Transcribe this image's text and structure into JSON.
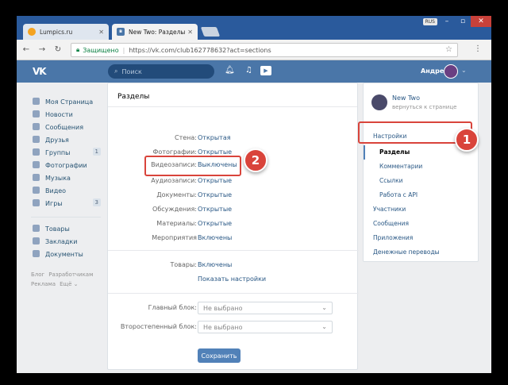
{
  "browser": {
    "tabs": [
      {
        "title": "Lumpics.ru",
        "active": false
      },
      {
        "title": "New Two: Разделы",
        "active": true
      }
    ],
    "lang_indicator": "RUS",
    "address": {
      "secure_label": "Защищено",
      "url": "https://vk.com/club162778632?act=sections"
    }
  },
  "vk_header": {
    "logo": "VK",
    "search_placeholder": "Поиск",
    "user_name": "Андрей"
  },
  "left_nav": {
    "items": [
      {
        "label": "Моя Страница",
        "icon": "home-icon"
      },
      {
        "label": "Новости",
        "icon": "news-icon"
      },
      {
        "label": "Сообщения",
        "icon": "messages-icon"
      },
      {
        "label": "Друзья",
        "icon": "friends-icon"
      },
      {
        "label": "Группы",
        "icon": "groups-icon",
        "count": "1"
      },
      {
        "label": "Фотографии",
        "icon": "photos-icon"
      },
      {
        "label": "Музыка",
        "icon": "music-icon"
      },
      {
        "label": "Видео",
        "icon": "video-icon"
      },
      {
        "label": "Игры",
        "icon": "games-icon",
        "count": "3"
      },
      {
        "label": "Товары",
        "icon": "goods-icon"
      },
      {
        "label": "Закладки",
        "icon": "bookmarks-icon"
      },
      {
        "label": "Документы",
        "icon": "documents-icon"
      }
    ],
    "footer": [
      "Блог",
      "Разработчикам",
      "Реклама",
      "Ещё ⌄"
    ]
  },
  "sections_panel": {
    "title": "Разделы",
    "rows": [
      {
        "label": "Стена:",
        "value": "Открытая"
      },
      {
        "label": "Фотографии:",
        "value": "Открытые"
      },
      {
        "label": "Видеозаписи:",
        "value": "Выключены"
      },
      {
        "label": "Аудиозаписи:",
        "value": "Открытые"
      },
      {
        "label": "Документы:",
        "value": "Открытые"
      },
      {
        "label": "Обсуждения:",
        "value": "Открытые"
      },
      {
        "label": "Материалы:",
        "value": "Открытые"
      },
      {
        "label": "Мероприятия",
        "value": "Включены"
      }
    ],
    "goods": {
      "label": "Товары:",
      "value": "Включены",
      "settings_link": "Показать настройки"
    },
    "main_block": {
      "label": "Главный блок:",
      "value": "Не выбрано"
    },
    "secondary_block": {
      "label": "Второстепенный блок:",
      "value": "Не выбрано"
    },
    "save_label": "Сохранить"
  },
  "right_menu": {
    "group_name": "New Two",
    "back_link": "вернуться к странице",
    "items": [
      {
        "label": "Настройки",
        "sub": false,
        "active": false
      },
      {
        "label": "Разделы",
        "sub": true,
        "active": true
      },
      {
        "label": "Комментарии",
        "sub": true,
        "active": false
      },
      {
        "label": "Ссылки",
        "sub": true,
        "active": false
      },
      {
        "label": "Работа с API",
        "sub": true,
        "active": false
      },
      {
        "label": "Участники",
        "sub": false,
        "active": false
      },
      {
        "label": "Сообщения",
        "sub": false,
        "active": false
      },
      {
        "label": "Приложения",
        "sub": false,
        "active": false
      },
      {
        "label": "Денежные переводы",
        "sub": false,
        "active": false
      }
    ]
  },
  "annotations": {
    "badge_1": "1",
    "badge_2": "2",
    "color": "#d9443b"
  },
  "colors": {
    "vk_blue": "#4a76a8",
    "link": "#2a5885",
    "button": "#5181b8"
  }
}
